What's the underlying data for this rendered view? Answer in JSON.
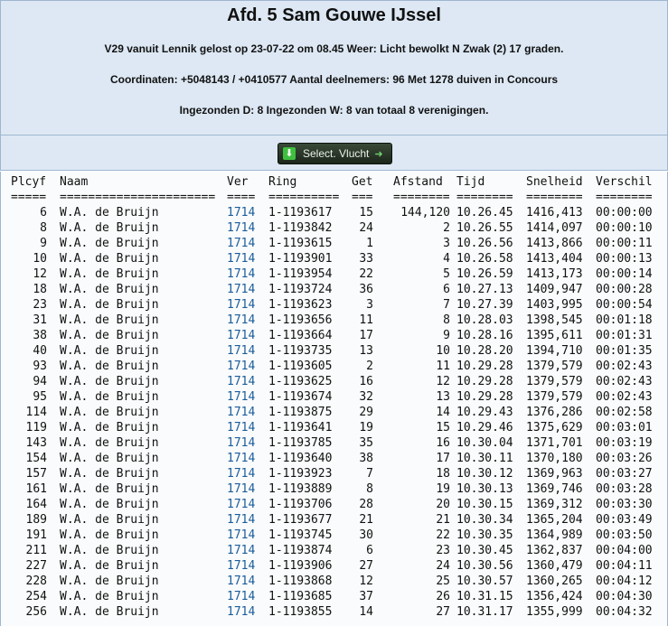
{
  "header": {
    "title": "Afd. 5 Sam Gouwe IJssel",
    "line1": "V29 vanuit Lennik gelost op 23-07-22 om 08.45 Weer: Licht bewolkt N Zwak (2) 17 graden.",
    "line2": "Coordinaten: +5048143 / +0410577 Aantal deelnemers: 96 Met 1278 duiven in Concours",
    "line3": "Ingezonden D: 8 Ingezonden W: 8 van totaal 8 verenigingen."
  },
  "toolbar": {
    "select_label": "Select. Vlucht",
    "select_icon": "download-icon"
  },
  "table": {
    "columns": [
      "Plcyf",
      "Naam",
      "Ver",
      "Ring",
      "Get",
      "Afstand",
      "Tijd",
      "Snelheid",
      "Verschil"
    ],
    "separators": [
      "=====",
      "======================",
      "====",
      "==========",
      "===",
      "========",
      "========",
      "========",
      "========"
    ],
    "rows": [
      [
        "6",
        "W.A. de Bruijn",
        "1714",
        "1-1193617",
        "15",
        "144,120",
        "10.26.45",
        "1416,413",
        "00:00:00"
      ],
      [
        "8",
        "W.A. de Bruijn",
        "1714",
        "1-1193842",
        "24",
        "2",
        "10.26.55",
        "1414,097",
        "00:00:10"
      ],
      [
        "9",
        "W.A. de Bruijn",
        "1714",
        "1-1193615",
        "1",
        "3",
        "10.26.56",
        "1413,866",
        "00:00:11"
      ],
      [
        "10",
        "W.A. de Bruijn",
        "1714",
        "1-1193901",
        "33",
        "4",
        "10.26.58",
        "1413,404",
        "00:00:13"
      ],
      [
        "12",
        "W.A. de Bruijn",
        "1714",
        "1-1193954",
        "22",
        "5",
        "10.26.59",
        "1413,173",
        "00:00:14"
      ],
      [
        "18",
        "W.A. de Bruijn",
        "1714",
        "1-1193724",
        "36",
        "6",
        "10.27.13",
        "1409,947",
        "00:00:28"
      ],
      [
        "23",
        "W.A. de Bruijn",
        "1714",
        "1-1193623",
        "3",
        "7",
        "10.27.39",
        "1403,995",
        "00:00:54"
      ],
      [
        "31",
        "W.A. de Bruijn",
        "1714",
        "1-1193656",
        "11",
        "8",
        "10.28.03",
        "1398,545",
        "00:01:18"
      ],
      [
        "38",
        "W.A. de Bruijn",
        "1714",
        "1-1193664",
        "17",
        "9",
        "10.28.16",
        "1395,611",
        "00:01:31"
      ],
      [
        "40",
        "W.A. de Bruijn",
        "1714",
        "1-1193735",
        "13",
        "10",
        "10.28.20",
        "1394,710",
        "00:01:35"
      ],
      [
        "93",
        "W.A. de Bruijn",
        "1714",
        "1-1193605",
        "2",
        "11",
        "10.29.28",
        "1379,579",
        "00:02:43"
      ],
      [
        "94",
        "W.A. de Bruijn",
        "1714",
        "1-1193625",
        "16",
        "12",
        "10.29.28",
        "1379,579",
        "00:02:43"
      ],
      [
        "95",
        "W.A. de Bruijn",
        "1714",
        "1-1193674",
        "32",
        "13",
        "10.29.28",
        "1379,579",
        "00:02:43"
      ],
      [
        "114",
        "W.A. de Bruijn",
        "1714",
        "1-1193875",
        "29",
        "14",
        "10.29.43",
        "1376,286",
        "00:02:58"
      ],
      [
        "119",
        "W.A. de Bruijn",
        "1714",
        "1-1193641",
        "19",
        "15",
        "10.29.46",
        "1375,629",
        "00:03:01"
      ],
      [
        "143",
        "W.A. de Bruijn",
        "1714",
        "1-1193785",
        "35",
        "16",
        "10.30.04",
        "1371,701",
        "00:03:19"
      ],
      [
        "154",
        "W.A. de Bruijn",
        "1714",
        "1-1193640",
        "38",
        "17",
        "10.30.11",
        "1370,180",
        "00:03:26"
      ],
      [
        "157",
        "W.A. de Bruijn",
        "1714",
        "1-1193923",
        "7",
        "18",
        "10.30.12",
        "1369,963",
        "00:03:27"
      ],
      [
        "161",
        "W.A. de Bruijn",
        "1714",
        "1-1193889",
        "8",
        "19",
        "10.30.13",
        "1369,746",
        "00:03:28"
      ],
      [
        "164",
        "W.A. de Bruijn",
        "1714",
        "1-1193706",
        "28",
        "20",
        "10.30.15",
        "1369,312",
        "00:03:30"
      ],
      [
        "189",
        "W.A. de Bruijn",
        "1714",
        "1-1193677",
        "21",
        "21",
        "10.30.34",
        "1365,204",
        "00:03:49"
      ],
      [
        "191",
        "W.A. de Bruijn",
        "1714",
        "1-1193745",
        "30",
        "22",
        "10.30.35",
        "1364,989",
        "00:03:50"
      ],
      [
        "211",
        "W.A. de Bruijn",
        "1714",
        "1-1193874",
        "6",
        "23",
        "10.30.45",
        "1362,837",
        "00:04:00"
      ],
      [
        "227",
        "W.A. de Bruijn",
        "1714",
        "1-1193906",
        "27",
        "24",
        "10.30.56",
        "1360,479",
        "00:04:11"
      ],
      [
        "228",
        "W.A. de Bruijn",
        "1714",
        "1-1193868",
        "12",
        "25",
        "10.30.57",
        "1360,265",
        "00:04:12"
      ],
      [
        "254",
        "W.A. de Bruijn",
        "1714",
        "1-1193685",
        "37",
        "26",
        "10.31.15",
        "1356,424",
        "00:04:30"
      ],
      [
        "256",
        "W.A. de Bruijn",
        "1714",
        "1-1193855",
        "14",
        "27",
        "10.31.17",
        "1355,999",
        "00:04:32"
      ]
    ]
  }
}
